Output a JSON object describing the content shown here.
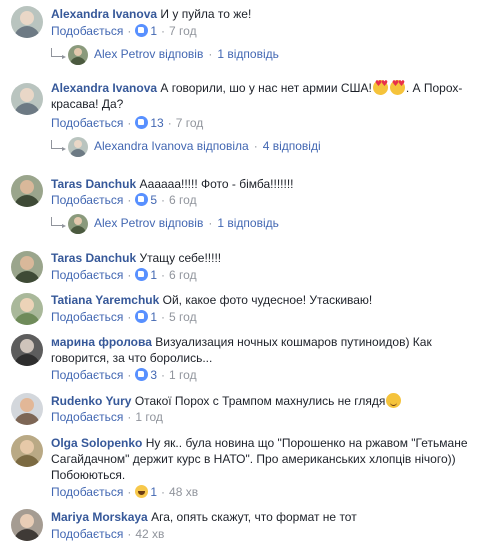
{
  "labels": {
    "like": "Подобається",
    "dot": "·"
  },
  "comments": [
    {
      "author": "Alexandra Ivanova",
      "text": "И у пуйла то же!",
      "likes": "1",
      "time": "7 год",
      "reply": {
        "name": "Alex Petrov",
        "verb": "відповів",
        "count": "1 відповідь"
      }
    },
    {
      "author": "Alexandra Ivanova",
      "text_before": "А говорили, шо у нас нет армии США!",
      "emojis": [
        "smiling-face-heart-eyes",
        "smiling-face-heart-eyes"
      ],
      "text_after": ". А Порох-красава! Да?",
      "likes": "13",
      "time": "7 год",
      "reply": {
        "name": "Alexandra Ivanova",
        "verb": "відповіла",
        "count": "4 відповіді"
      }
    },
    {
      "author": "Taras Danchuk",
      "text": "Аааааа!!!!! Фото - бімба!!!!!!!",
      "likes": "5",
      "time": "6 год",
      "reply": {
        "name": "Alex Petrov",
        "verb": "відповів",
        "count": "1 відповідь"
      }
    },
    {
      "author": "Taras Danchuk",
      "text": "Утащу себе!!!!!",
      "likes": "1",
      "time": "6 год"
    },
    {
      "author": "Tatiana Yaremchuk",
      "text": "Ой, какое фото чудесное! Утаскиваю!",
      "likes": "1",
      "time": "5 год"
    },
    {
      "author": "марина фролова",
      "text": "Визуализация ночных кошмаров путиноидов) Как говорится, за что боролись...",
      "likes": "3",
      "time": "1 год"
    },
    {
      "author": "Rudenko Yury",
      "text": "Отакої Порох с Трампом махнулись не глядя",
      "emojis": [
        "winking-face"
      ],
      "time": "1 год"
    },
    {
      "author": "Olga Solopenko",
      "text": "Ну як.. була новина що \"Порошенко на ржавом \"Гетьмане Сагайдачном\" держит курс в НАТО\". Про американських хлопців нічого)) Побоюються.",
      "likes": "1",
      "time": "48 хв",
      "reaction": "haha"
    },
    {
      "author": "Mariya Morskaya",
      "text": "Ага, опять скажут, что формат не тот",
      "time": "42 хв"
    }
  ],
  "colors": {
    "link": "#365899",
    "action": "#4267b2",
    "meta": "#90949c",
    "like": "#5890ff"
  }
}
